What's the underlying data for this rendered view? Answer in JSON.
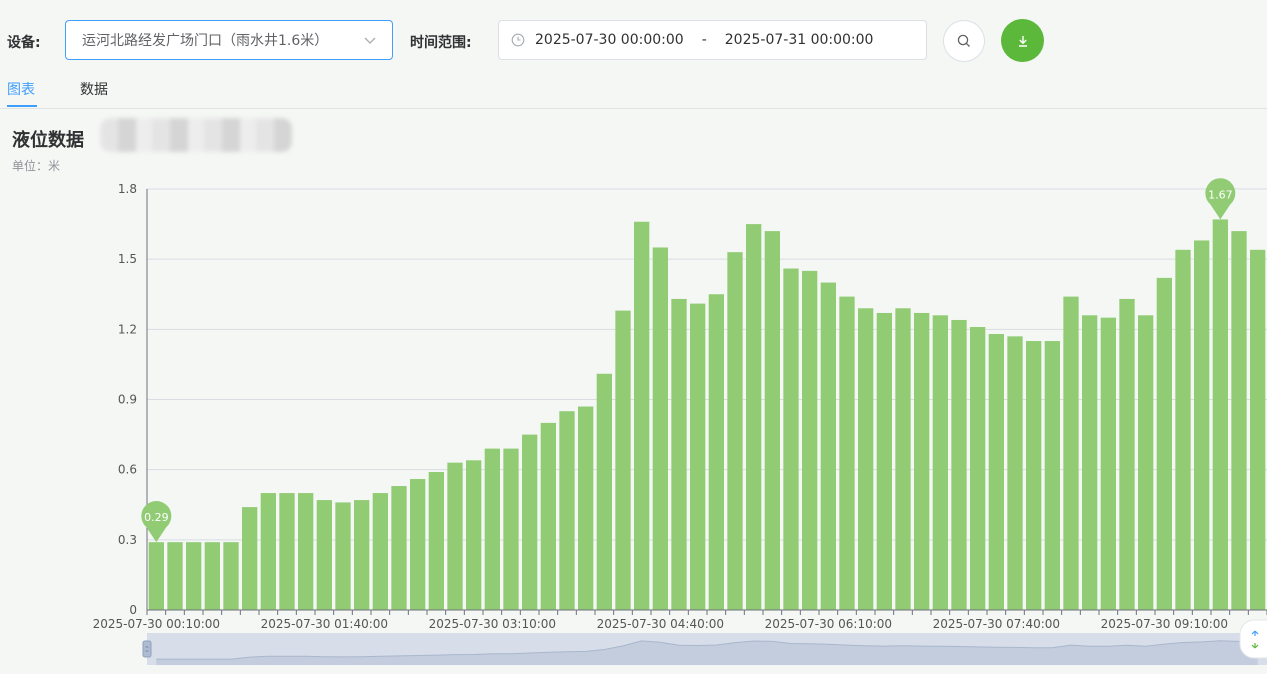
{
  "toolbar": {
    "device_label": "设备:",
    "device_value": "运河北路经发广场门口（雨水井1.6米）",
    "time_label": "时间范围:",
    "start_time": "2025-07-30 00:00:00",
    "range_sep": "-",
    "end_time": "2025-07-31 00:00:00",
    "accent_color": "#409eff",
    "download_color": "#5cb83a"
  },
  "tabs": [
    {
      "label": "图表",
      "active": true
    },
    {
      "label": "数据",
      "active": false
    }
  ],
  "chart_header": {
    "title": "液位数据",
    "unit": "单位：米"
  },
  "chart_data": {
    "type": "bar",
    "title": "液位数据",
    "ylim": [
      0,
      1.8
    ],
    "yticks": [
      "0",
      "0.3",
      "0.6",
      "0.9",
      "1.2",
      "1.5",
      "1.8"
    ],
    "grid": true,
    "bar_color": "#91cc75",
    "x_tick_labels": [
      "2025-07-30 00:10:00",
      "2025-07-30 01:40:00",
      "2025-07-30 03:10:00",
      "2025-07-30 04:40:00",
      "2025-07-30 06:10:00",
      "2025-07-30 07:40:00",
      "2025-07-30 09:10:00"
    ],
    "x_tick_every": 9,
    "values": [
      0.29,
      0.29,
      0.29,
      0.29,
      0.29,
      0.44,
      0.5,
      0.5,
      0.5,
      0.47,
      0.46,
      0.47,
      0.5,
      0.53,
      0.56,
      0.59,
      0.63,
      0.64,
      0.69,
      0.69,
      0.75,
      0.8,
      0.85,
      0.87,
      1.01,
      1.28,
      1.66,
      1.55,
      1.33,
      1.31,
      1.35,
      1.53,
      1.65,
      1.62,
      1.46,
      1.45,
      1.4,
      1.34,
      1.29,
      1.27,
      1.29,
      1.27,
      1.26,
      1.24,
      1.21,
      1.18,
      1.17,
      1.15,
      1.15,
      1.34,
      1.26,
      1.25,
      1.33,
      1.26,
      1.42,
      1.54,
      1.58,
      1.67,
      1.62,
      1.54
    ],
    "markers": [
      {
        "index": 0,
        "label": "0.29"
      },
      {
        "index": 57,
        "label": "1.67"
      }
    ]
  }
}
